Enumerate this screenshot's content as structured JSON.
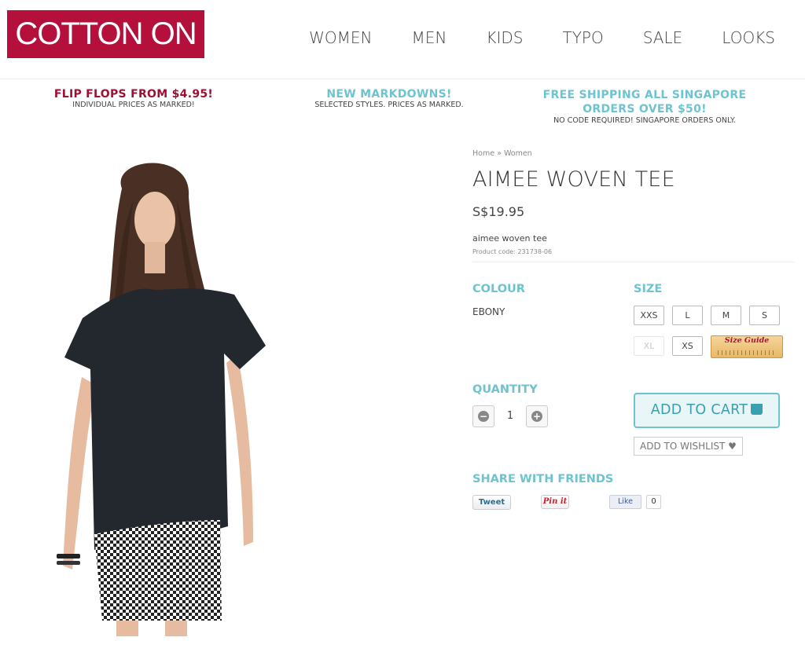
{
  "brand": {
    "logo_text": "COTTON ON",
    "logo_color": "#b5103c",
    "accent": "#6ec3d0"
  },
  "nav": {
    "items": [
      "WOMEN",
      "MEN",
      "KIDS",
      "TYPO",
      "SALE",
      "LOOKS"
    ]
  },
  "promos": [
    {
      "headline": "FLIP FLOPS FROM $4.95!",
      "sub": "INDIVIDUAL PRICES AS MARKED!"
    },
    {
      "headline": "NEW MARKDOWNS!",
      "sub": "SELECTED STYLES. PRICES AS MARKED."
    },
    {
      "headline_line1": "FREE SHIPPING ALL SINGAPORE",
      "headline_line2": "ORDERS OVER $50!",
      "sub": "NO CODE REQUIRED! SINGAPORE ORDERS ONLY."
    }
  ],
  "breadcrumb": {
    "home": "Home",
    "sep": "»",
    "current": "Women"
  },
  "product": {
    "title": "AIMEE WOVEN TEE",
    "price": "S$19.95",
    "description": "aimee woven tee",
    "code": "Product code: 231738-06"
  },
  "colour": {
    "heading": "COLOUR",
    "value": "EBONY"
  },
  "size": {
    "heading": "SIZE",
    "options": [
      "XXS",
      "L",
      "M",
      "S",
      "XL",
      "XS"
    ],
    "size_guide_label": "Size Guide"
  },
  "quantity": {
    "heading": "QUANTITY",
    "value": "1",
    "minus": "−",
    "plus": "+"
  },
  "actions": {
    "add_to_cart": "ADD TO CART",
    "add_to_wishlist": "ADD TO WISHLIST ♥"
  },
  "share": {
    "heading": "SHARE WITH FRIENDS",
    "tweet": "Tweet",
    "pin": "Pin it",
    "like": "Like",
    "like_count": "0"
  }
}
